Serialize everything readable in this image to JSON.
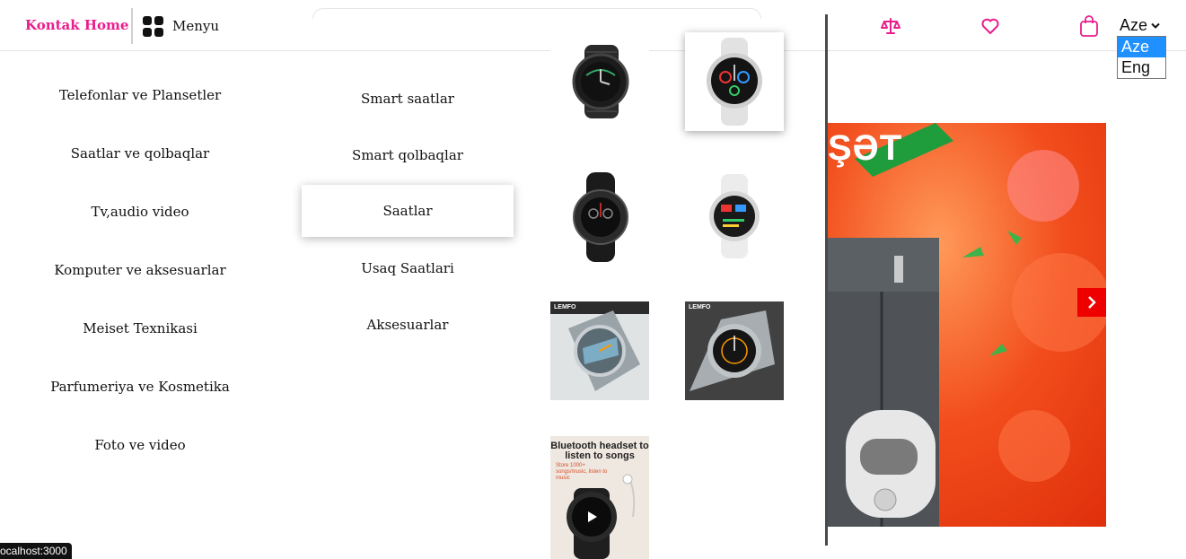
{
  "header": {
    "logo": "Kontak Home",
    "menu_label": "Menyu",
    "icons": [
      "compare-scale-icon",
      "heart-icon",
      "shopping-bag-icon"
    ],
    "language": {
      "selected": "Aze",
      "options": [
        "Aze",
        "Eng"
      ]
    }
  },
  "categories": [
    "Telefonlar ve Plansetler",
    "Saatlar ve qolbaqlar",
    "Tv,audio video",
    "Komputer ve aksesuarlar",
    "Meiset Texnikasi",
    "Parfumeriya ve Kosmetika",
    "Foto ve video"
  ],
  "subcategories": {
    "items": [
      "Smart saatlar",
      "Smart qolbaqlar",
      "Saatlar",
      "Usaq Saatlari",
      "Aksesuarlar"
    ],
    "active": "Saatlar"
  },
  "products": {
    "brand": "LEMFO",
    "promo_title": "Bluetooth headset to listen to songs",
    "promo_sub": "Store 1000+ songs/music, listen to music"
  },
  "banner": {
    "text": "ŞƏT"
  },
  "status_bar": "ocalhost:3000",
  "colors": {
    "accent": "#e91e8c",
    "slider_button": "#ee0000",
    "select_highlight": "#1e90ff"
  }
}
